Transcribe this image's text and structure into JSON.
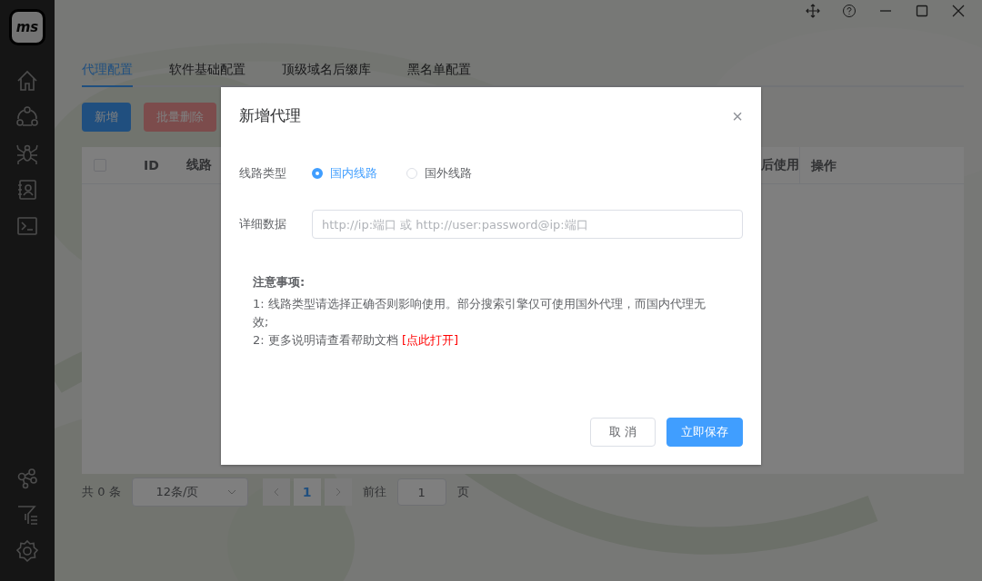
{
  "logo": "ms",
  "tabs": [
    {
      "label": "代理配置",
      "selected": true
    },
    {
      "label": "软件基础配置",
      "selected": false
    },
    {
      "label": "顶级域名后缀库",
      "selected": false
    },
    {
      "label": "黑名单配置",
      "selected": false
    }
  ],
  "toolbar": {
    "add": "新增",
    "batch_delete": "批量删除"
  },
  "table": {
    "select_all_checked": false,
    "columns": [
      "ID",
      "线路",
      "后使用",
      "操作"
    ]
  },
  "pagination": {
    "total": "共 0 条",
    "page_size": "12条/页",
    "current_page": "1",
    "goto_label": "前往",
    "goto_value": "1",
    "page_unit": "页"
  },
  "dialog": {
    "title": "新增代理",
    "close": "×",
    "route_label": "线路类型",
    "route_types": [
      {
        "label": "国内线路",
        "selected": true
      },
      {
        "label": "国外线路",
        "selected": false
      }
    ],
    "detail_label": "详细数据",
    "detail_placeholder": "http://ip:端口 或 http://user:password@ip:端口",
    "notes_title": "注意事项:",
    "notes": [
      "1: 线路类型请选择正确否则影响使用。部分搜索引擎仅可使用国外代理，而国内代理无效;",
      "2: 更多说明请查看帮助文档"
    ],
    "notes_link": "[点此打开]",
    "cancel": "取 消",
    "save": "立即保存"
  }
}
